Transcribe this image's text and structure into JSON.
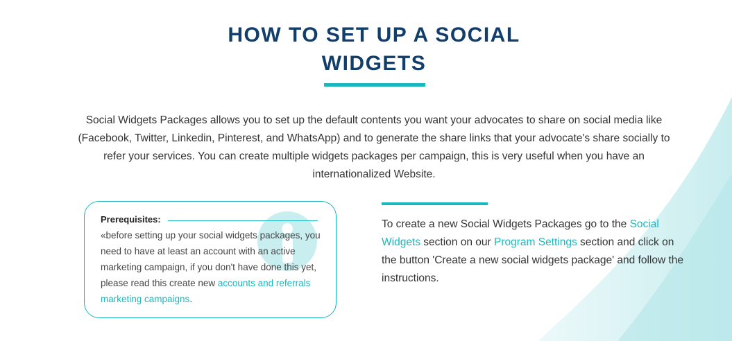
{
  "page": {
    "title_line1": "HOW TO SET UP A SOCIAL",
    "title_line2": "WIDGETS",
    "intro": "Social Widgets Packages allows you to set up the default contents you want your advocates to share on social media like (Facebook, Twitter, Linkedin, Pinterest, and WhatsApp) and to generate the share links that your advocate's share socially to refer your services. You can create multiple widgets packages per campaign, this is very useful when you have an internationalized Website."
  },
  "prerequisites": {
    "title": "Prerequisites:",
    "text": "«before setting up your social widgets packages, you need to have at least an account with an active marketing campaign, if you don't have done this yet, please read this create new ",
    "link": "accounts and referrals marketing campaigns",
    "suffix": "."
  },
  "instructions": {
    "part1": "To create a new Social Widgets Packages go to the ",
    "link1": "Social Widgets",
    "part2": " section on our ",
    "link2": "Program Settings",
    "part3": " section and click on the button 'Create a new social widgets package' and follow the instructions."
  },
  "colors": {
    "accent": "#19b8bf",
    "heading": "#123e6b",
    "text": "#333333",
    "info_circle": "#c8eef0"
  },
  "icons": {
    "info": "info-icon"
  }
}
